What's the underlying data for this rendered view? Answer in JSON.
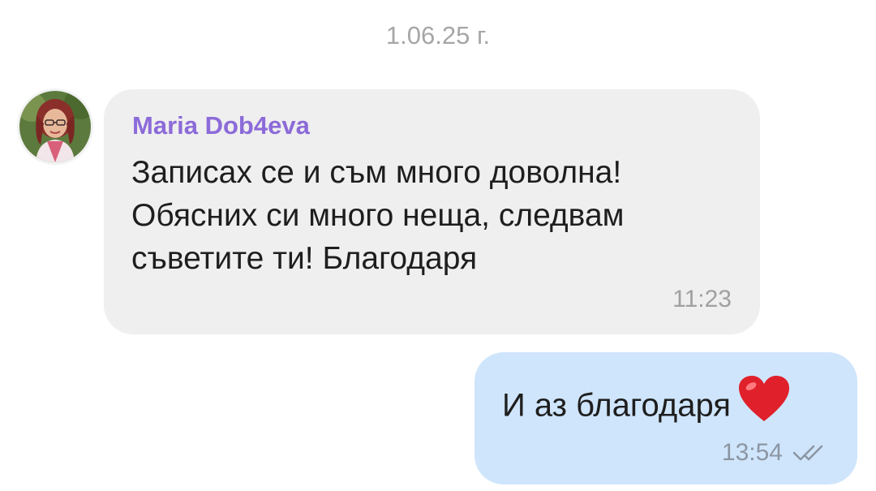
{
  "chat": {
    "date_separator": "1.06.25 г.",
    "messages": [
      {
        "direction": "incoming",
        "sender": "Maria Dob4eva",
        "text": "Записах се и съм много доволна! Обясних си много неща, следвам съветите ти! Благодаря",
        "time": "11:23",
        "avatar_icon": "user-avatar-photo"
      },
      {
        "direction": "outgoing",
        "text": "И аз благодаря",
        "emoji_icon": "red-heart-icon",
        "time": "13:54",
        "status_icon": "double-check-read-icon"
      }
    ]
  },
  "colors": {
    "background": "#ffffff",
    "incoming_bubble": "#efefef",
    "outgoing_bubble": "#cfe5fc",
    "sender_name": "#8c6bd9",
    "timestamp": "#a0a0a0",
    "heart": "#e0202a"
  }
}
